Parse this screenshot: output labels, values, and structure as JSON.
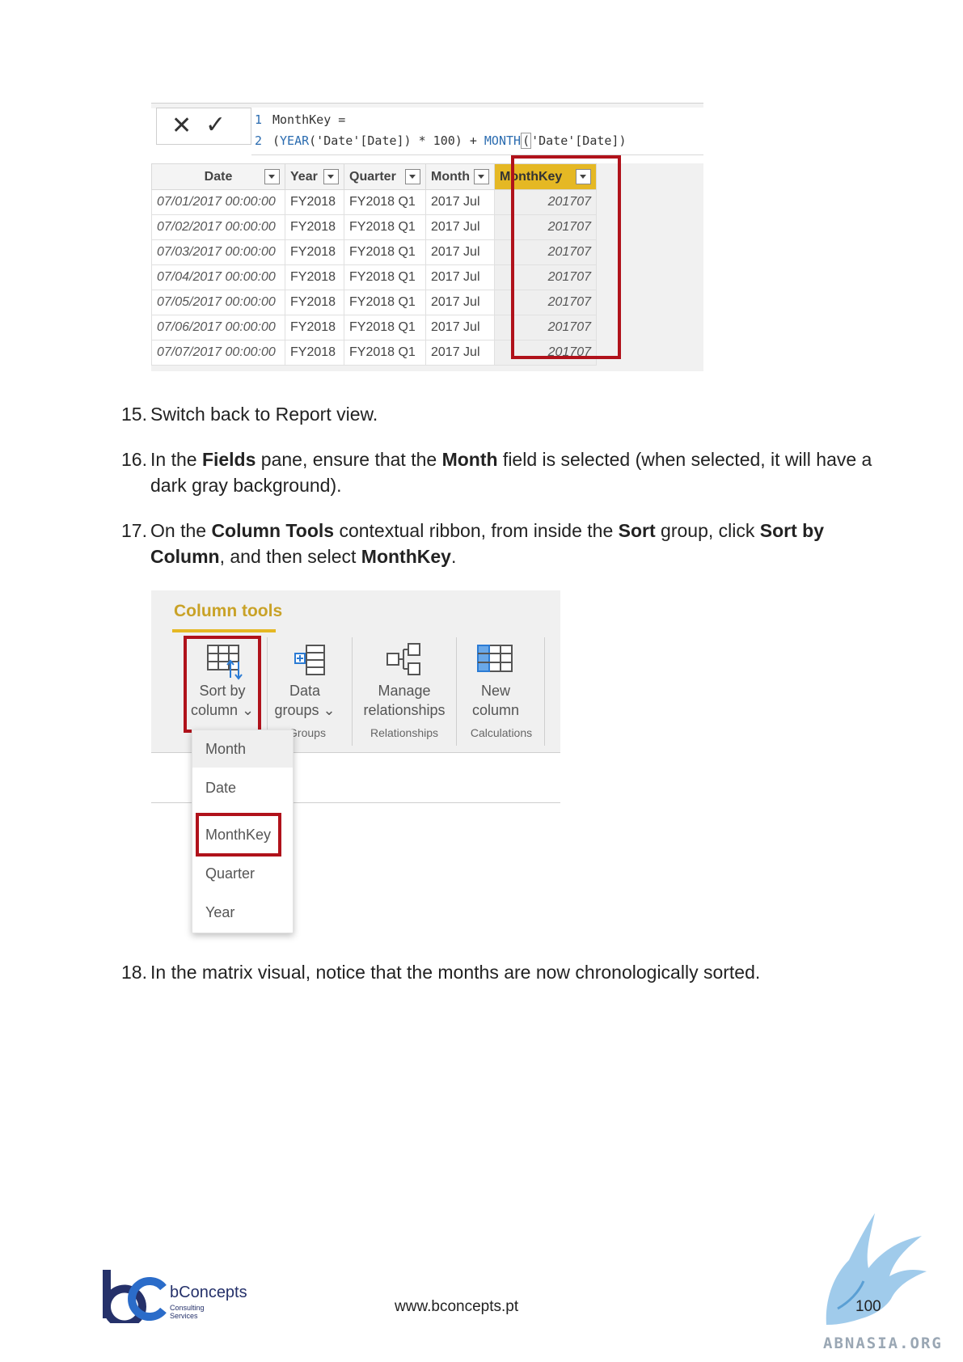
{
  "formula": {
    "line1_num": "1",
    "line1_text": "MonthKey =",
    "line2_num": "2",
    "line2_open": "(",
    "line2_fn1": "YEAR",
    "line2_mid": "('Date'[Date]) * 100) + ",
    "line2_fn2": "MONTH",
    "line2_cur": "(",
    "line2_end": "'Date'[Date])",
    "cancel_symbol": "✕",
    "commit_symbol": "✓"
  },
  "table": {
    "headers": [
      "Date",
      "Year",
      "Quarter",
      "Month",
      "MonthKey"
    ],
    "rows": [
      [
        "07/01/2017 00:00:00",
        "FY2018",
        "FY2018 Q1",
        "2017 Jul",
        "201707"
      ],
      [
        "07/02/2017 00:00:00",
        "FY2018",
        "FY2018 Q1",
        "2017 Jul",
        "201707"
      ],
      [
        "07/03/2017 00:00:00",
        "FY2018",
        "FY2018 Q1",
        "2017 Jul",
        "201707"
      ],
      [
        "07/04/2017 00:00:00",
        "FY2018",
        "FY2018 Q1",
        "2017 Jul",
        "201707"
      ],
      [
        "07/05/2017 00:00:00",
        "FY2018",
        "FY2018 Q1",
        "2017 Jul",
        "201707"
      ],
      [
        "07/06/2017 00:00:00",
        "FY2018",
        "FY2018 Q1",
        "2017 Jul",
        "201707"
      ],
      [
        "07/07/2017 00:00:00",
        "FY2018",
        "FY2018 Q1",
        "2017 Jul",
        "201707"
      ]
    ]
  },
  "steps": {
    "s15": {
      "num": "15.",
      "text": "Switch back to Report view."
    },
    "s16": {
      "num": "16.",
      "a": "In the ",
      "b1": "Fields",
      "c": " pane, ensure that the ",
      "b2": "Month",
      "d": " field is selected (when selected, it will have a dark gray background)."
    },
    "s17": {
      "num": "17.",
      "a": "On the ",
      "b1": "Column Tools",
      "c": " contextual ribbon, from inside the ",
      "b2": "Sort",
      "d": " group, click ",
      "b3": "Sort by Column",
      "e": ", and then select ",
      "b4": "MonthKey",
      "f": "."
    },
    "s18": {
      "num": "18.",
      "text": "In the matrix visual, notice that the months are now chronologically sorted."
    }
  },
  "ribbon": {
    "title": "Column tools",
    "sort_by_column_l1": "Sort by",
    "sort_by_column_l2": "column ⌄",
    "data_groups_l1": "Data",
    "data_groups_l2": "groups ⌄",
    "manage_rel_l1": "Manage",
    "manage_rel_l2": "relationships",
    "new_column_l1": "New",
    "new_column_l2": "column",
    "group_groups": "Groups",
    "group_relationships": "Relationships",
    "group_calculations": "Calculations",
    "dropdown": [
      "Month",
      "Date",
      "MonthKey",
      "Quarter",
      "Year"
    ]
  },
  "footer": {
    "url": "www.bconcepts.pt",
    "page": "100",
    "brand": "bConcepts",
    "brand_sub1": "Consulting",
    "brand_sub2": "Services",
    "watermark": "ABNASIA.ORG"
  },
  "colors": {
    "highlight_red": "#b0121b",
    "accent_gold": "#e5b824",
    "brand_blue": "#25316a"
  }
}
